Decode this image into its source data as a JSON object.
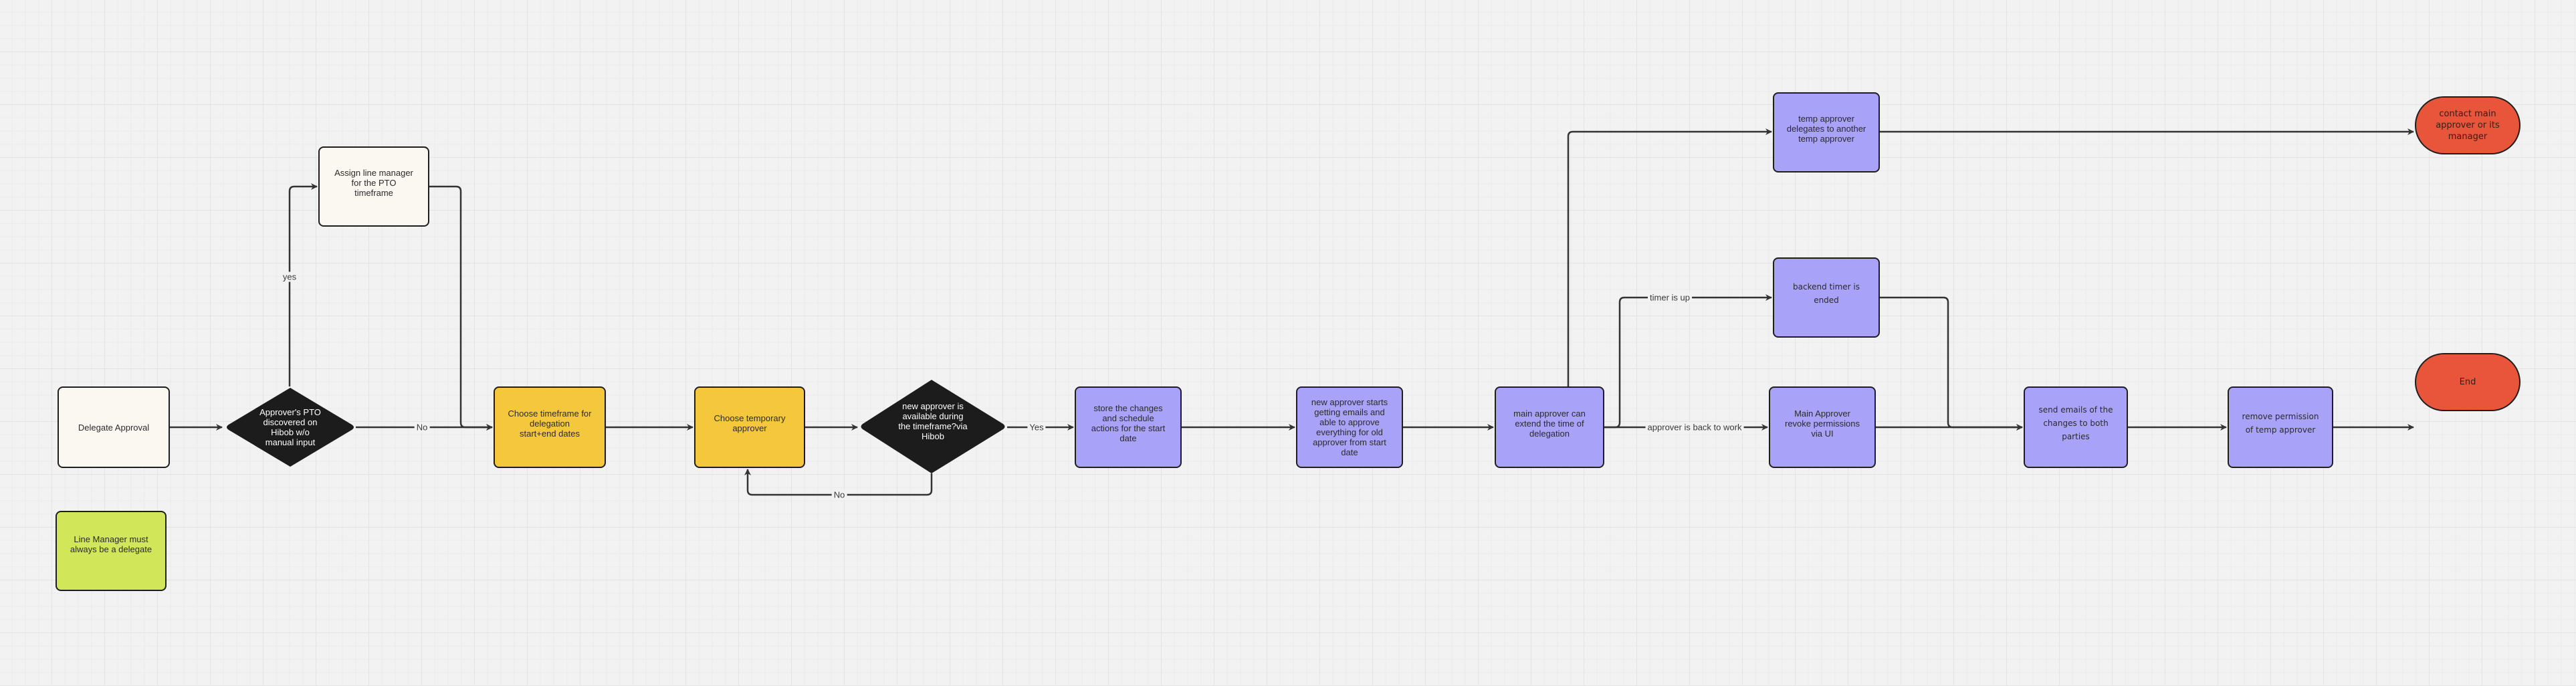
{
  "diagram": {
    "type": "flowchart",
    "nodes": {
      "delegate_approval": {
        "label": "Delegate Approval",
        "shape": "rounded-rect",
        "color": "#fbf7f1"
      },
      "line_manager_note": {
        "label": "Line Manager must\nalways be a delegate",
        "shape": "rounded-rect",
        "color": "#d2e65a"
      },
      "pto_discovered": {
        "label": "Approver's PTO\ndiscovered on\nHibob w/o\nmanual input",
        "shape": "diamond",
        "color": "#1c1c1c"
      },
      "assign_line_manager": {
        "label": "Assign line manager\nfor the PTO\ntimeframe",
        "shape": "rounded-rect",
        "color": "#fbf7f1"
      },
      "choose_timeframe": {
        "label": "Choose timeframe for\ndelegation\nstart+end dates",
        "shape": "rounded-rect",
        "color": "#f4c73c"
      },
      "choose_temp_approver": {
        "label": "Choose temporary\napprover",
        "shape": "rounded-rect",
        "color": "#f4c73c"
      },
      "approver_available": {
        "label": "new approver is\navailable during\nthe timeframe?via\nHibob",
        "shape": "diamond",
        "color": "#1c1c1c"
      },
      "store_changes": {
        "label": "store the changes\nand schedule\nactions for the start\ndate",
        "shape": "rounded-rect",
        "color": "#a8a2f9"
      },
      "new_approver_starts": {
        "label": "new approver starts\ngetting emails and\nable to approve\neverything for old\napprover from start\ndate",
        "shape": "rounded-rect",
        "color": "#a8a2f9"
      },
      "main_can_extend": {
        "label": "main approver can\nextend the time of\ndelegation",
        "shape": "rounded-rect",
        "color": "#a8a2f9"
      },
      "temp_delegates": {
        "label": "temp approver\ndelegates to another\ntemp approver",
        "shape": "rounded-rect",
        "color": "#a8a2f9"
      },
      "backend_timer": {
        "label": "backend timer is\nended",
        "shape": "rounded-rect",
        "color": "#a8a2f9"
      },
      "main_revoke": {
        "label": "Main Approver\nrevoke permissions\nvia UI",
        "shape": "rounded-rect",
        "color": "#a8a2f9"
      },
      "send_emails": {
        "label": "send emails of the\nchanges to both\nparties",
        "shape": "rounded-rect",
        "color": "#a8a2f9"
      },
      "remove_permission": {
        "label": "remove permission\nof temp approver",
        "shape": "rounded-rect",
        "color": "#a8a2f9"
      },
      "contact_main": {
        "label": "contact main\napprover or its\nmanager",
        "shape": "terminal",
        "color": "#e8553a"
      },
      "end": {
        "label": "End",
        "shape": "terminal",
        "color": "#e8553a"
      }
    },
    "edges": [
      {
        "from": "delegate_approval",
        "to": "pto_discovered",
        "label": ""
      },
      {
        "from": "pto_discovered",
        "to": "assign_line_manager",
        "label": "yes"
      },
      {
        "from": "pto_discovered",
        "to": "choose_timeframe",
        "label": "No"
      },
      {
        "from": "assign_line_manager",
        "to": "choose_timeframe",
        "label": ""
      },
      {
        "from": "choose_timeframe",
        "to": "choose_temp_approver",
        "label": ""
      },
      {
        "from": "choose_temp_approver",
        "to": "approver_available",
        "label": ""
      },
      {
        "from": "approver_available",
        "to": "store_changes",
        "label": "Yes"
      },
      {
        "from": "approver_available",
        "to": "choose_temp_approver",
        "label": "No"
      },
      {
        "from": "store_changes",
        "to": "new_approver_starts",
        "label": ""
      },
      {
        "from": "new_approver_starts",
        "to": "main_can_extend",
        "label": ""
      },
      {
        "from": "main_can_extend",
        "to": "temp_delegates",
        "label": ""
      },
      {
        "from": "main_can_extend",
        "to": "backend_timer",
        "label": "timer is up"
      },
      {
        "from": "main_can_extend",
        "to": "main_revoke",
        "label": "approver is back to work"
      },
      {
        "from": "temp_delegates",
        "to": "contact_main",
        "label": ""
      },
      {
        "from": "backend_timer",
        "to": "send_emails",
        "label": ""
      },
      {
        "from": "main_revoke",
        "to": "send_emails",
        "label": ""
      },
      {
        "from": "send_emails",
        "to": "remove_permission",
        "label": ""
      },
      {
        "from": "remove_permission",
        "to": "end",
        "label": ""
      }
    ],
    "edge_labels": {
      "yes": "yes",
      "no_1": "No",
      "yes_2": "Yes",
      "no_2": "No",
      "timer_is_up": "timer is up",
      "approver_back": "approver is back to work"
    },
    "colors": {
      "stroke": "#333333",
      "background": "#f2f2f2"
    }
  }
}
